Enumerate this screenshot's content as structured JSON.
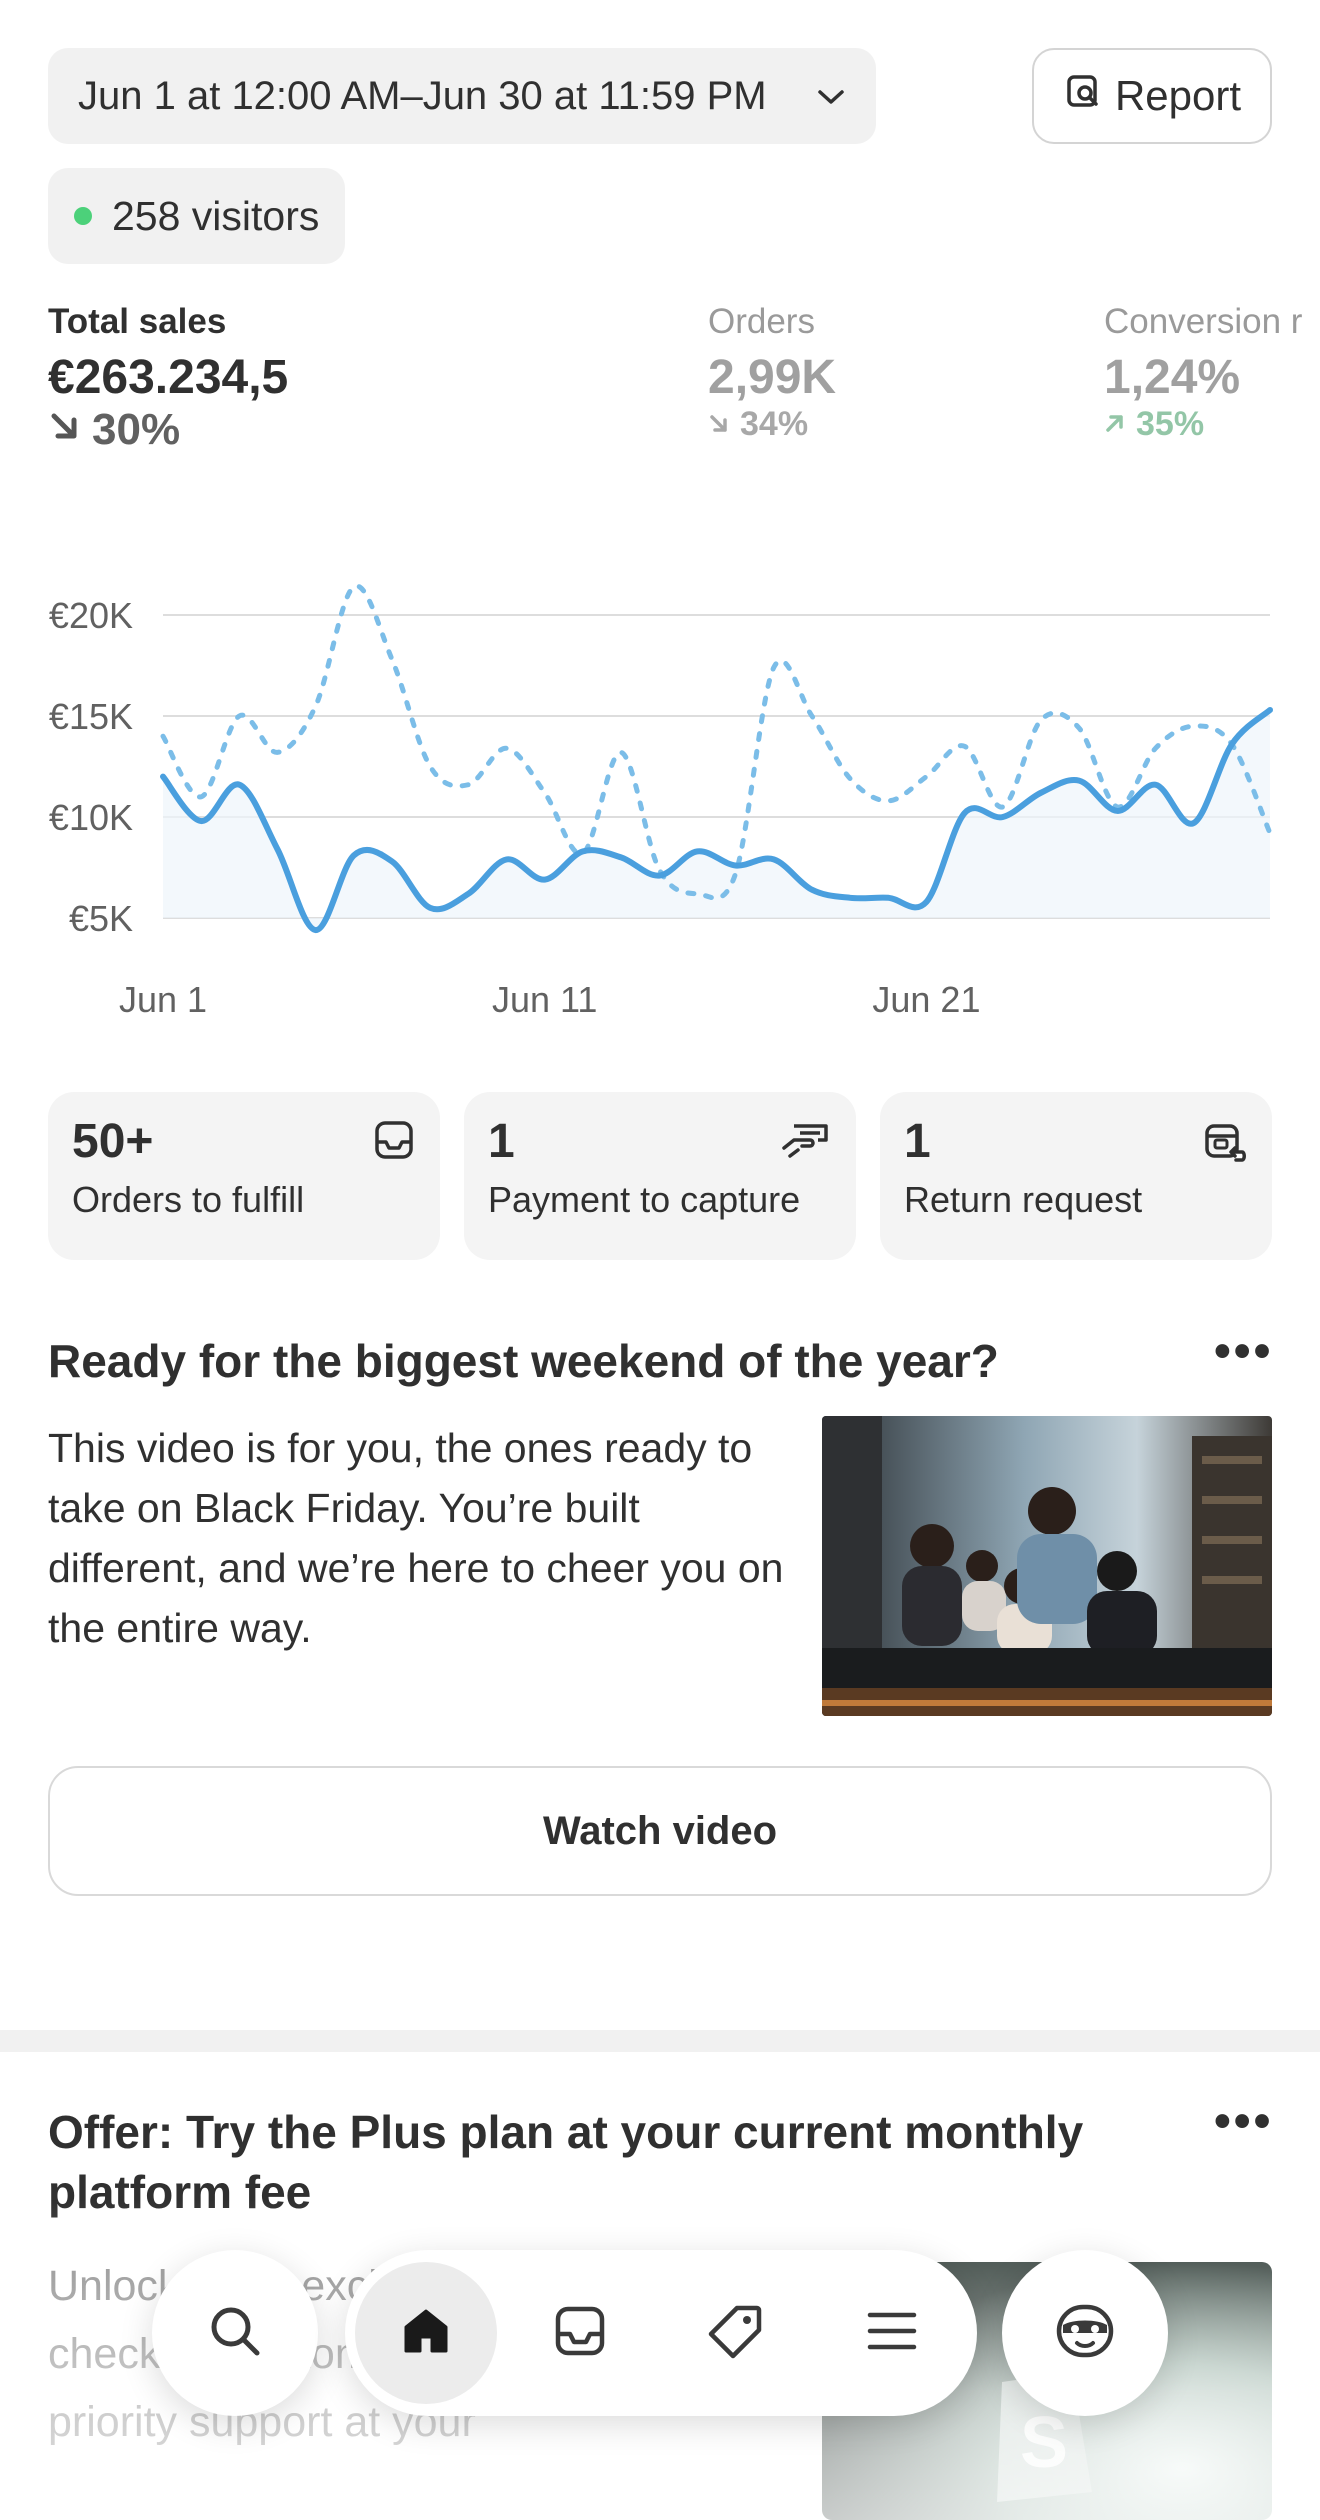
{
  "header": {
    "date_range": "Jun 1 at 12:00 AM–Jun 30 at 11:59 PM",
    "report_label": "Report",
    "visitors_label": "258 visitors"
  },
  "metrics": [
    {
      "label": "Total sales",
      "value": "€263.234,5",
      "change": "30%",
      "direction": "down"
    },
    {
      "label": "Orders",
      "value": "2,99K",
      "change": "34%",
      "direction": "down"
    },
    {
      "label": "Conversion r",
      "value": "1,24%",
      "change": "35%",
      "direction": "up"
    }
  ],
  "chart_data": {
    "type": "line",
    "yticks": [
      "€20K",
      "€15K",
      "€10K",
      "€5K"
    ],
    "ylim": [
      5000,
      20000
    ],
    "xticks": [
      "Jun 1",
      "Jun 11",
      "Jun 21"
    ],
    "x": [
      1,
      2,
      3,
      4,
      5,
      6,
      7,
      8,
      9,
      10,
      11,
      12,
      13,
      14,
      15,
      16,
      17,
      18,
      19,
      20,
      21,
      22,
      23,
      24,
      25,
      26,
      27,
      28,
      29,
      30
    ],
    "series": [
      {
        "values": [
          12000,
          9800,
          11600,
          8400,
          4400,
          8100,
          7800,
          5500,
          6200,
          7900,
          6900,
          8300,
          8000,
          7100,
          8300,
          7600,
          7900,
          6400,
          6000,
          6000,
          5800,
          10200,
          10000,
          11200,
          11800,
          10300,
          11600,
          9700,
          13600,
          15300
        ],
        "style": "solid",
        "color": "#4a9fde"
      },
      {
        "values": [
          14000,
          11000,
          15000,
          13200,
          15500,
          21400,
          17800,
          12500,
          11600,
          13400,
          11200,
          8200,
          13200,
          7400,
          6200,
          7200,
          17400,
          15000,
          11900,
          10800,
          12000,
          13500,
          10500,
          14800,
          14400,
          10500,
          13400,
          14500,
          13600,
          9200
        ],
        "style": "dotted",
        "color": "#7bbde8"
      }
    ]
  },
  "cards": [
    {
      "number": "50+",
      "label": "Orders to fulfill",
      "icon": "inbox-icon"
    },
    {
      "number": "1",
      "label": "Payment to capture",
      "icon": "cash-icon"
    },
    {
      "number": "1",
      "label": "Return request",
      "icon": "return-icon"
    }
  ],
  "promo": {
    "title": "Ready for the biggest weekend of the year?",
    "body": "This video is for you, the ones ready to take on Black Friday. You’re built different, and we’re here to cheer you on the entire way.",
    "button": "Watch video"
  },
  "offer": {
    "title": "Offer: Try the Plus plan at your current monthly platform fee",
    "body": "Unlock more exclusive features like checkout customizations, B2B, and priority support at your"
  },
  "nav": [
    "search-icon",
    "home-icon",
    "inbox-icon",
    "tag-icon",
    "menu-icon",
    "sidekick-icon"
  ]
}
